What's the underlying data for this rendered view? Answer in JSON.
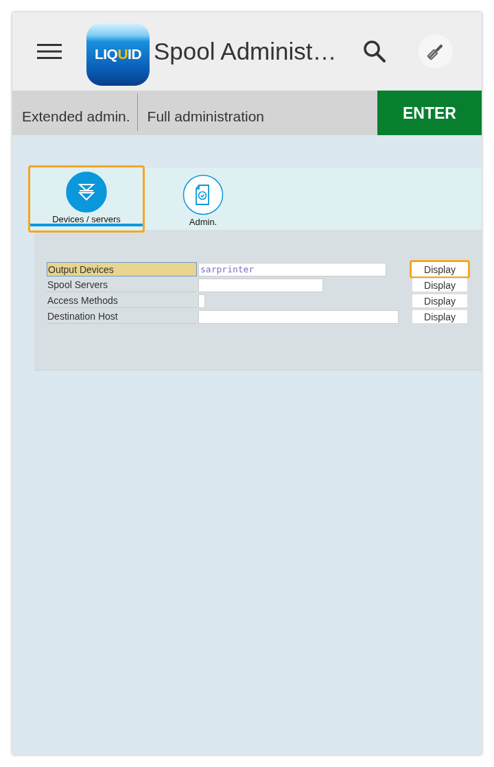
{
  "header": {
    "logo": {
      "text_start": "LIQ",
      "text_highlight": "U",
      "text_end": "ID"
    },
    "title": "Spool Administ…"
  },
  "toolbar": {
    "items": [
      {
        "label": "Extended admin."
      },
      {
        "label": "Full administration"
      }
    ],
    "enter_button": "ENTER"
  },
  "tabs": [
    {
      "label": "Devices / servers",
      "kind": "devices",
      "selected": true
    },
    {
      "label": "Admin.",
      "kind": "document",
      "selected": false
    }
  ],
  "form": {
    "rows": [
      {
        "label": "Output Devices",
        "value": "sarprinter",
        "focused": true,
        "button": "Display",
        "button_focused": true
      },
      {
        "label": "Spool Servers",
        "value": "",
        "focused": false,
        "button": "Display",
        "button_focused": false
      },
      {
        "label": "Access Methods",
        "value": "",
        "focused": false,
        "button": "Display",
        "button_focused": false
      },
      {
        "label": "Destination Host",
        "value": "",
        "focused": false,
        "button": "Display",
        "button_focused": false
      }
    ]
  }
}
